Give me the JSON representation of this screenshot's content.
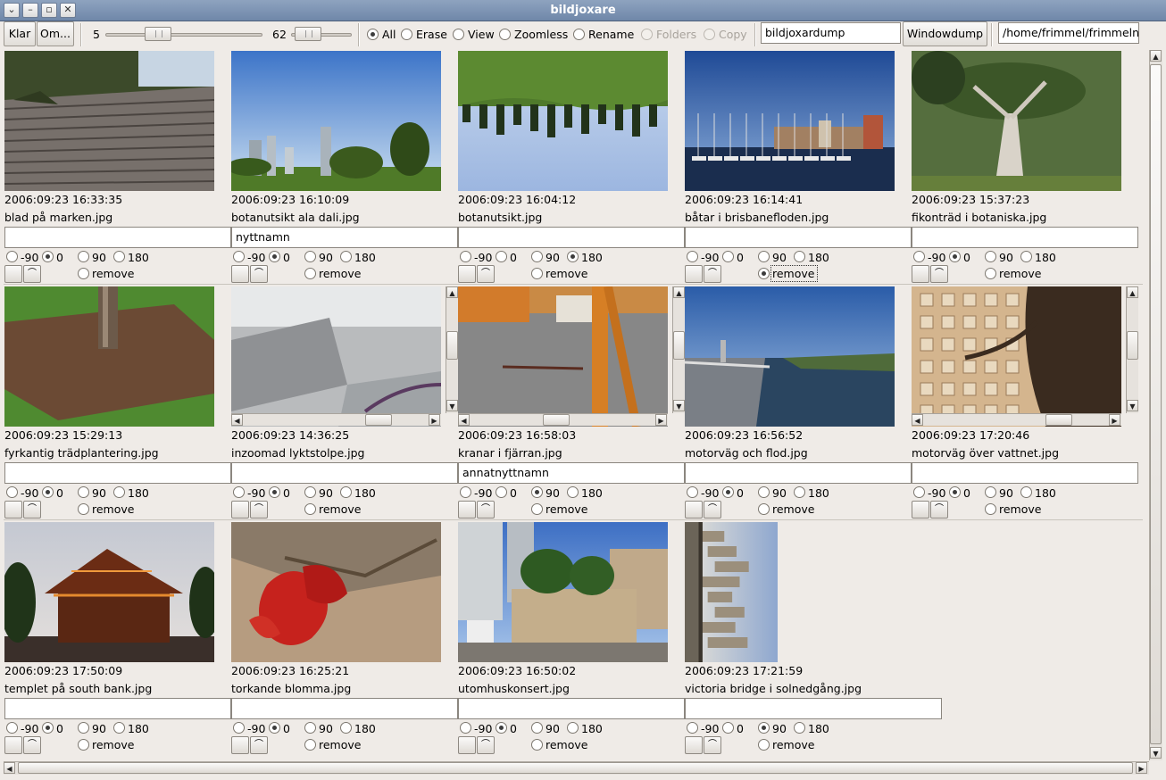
{
  "window": {
    "title": "bildjoxare"
  },
  "toolbar": {
    "klar_label": "Klar",
    "om_label": "Om...",
    "slider1_value": "5",
    "slider2_value": "62",
    "modes": [
      {
        "label": "All",
        "selected": true,
        "enabled": true
      },
      {
        "label": "Erase",
        "selected": false,
        "enabled": true
      },
      {
        "label": "View",
        "selected": false,
        "enabled": true
      },
      {
        "label": "Zoomless",
        "selected": false,
        "enabled": true
      },
      {
        "label": "Rename",
        "selected": false,
        "enabled": true
      },
      {
        "label": "Folders",
        "selected": false,
        "enabled": false
      },
      {
        "label": "Copy",
        "selected": false,
        "enabled": false
      }
    ],
    "dump_name": "bildjoxardump",
    "windowdump_label": "Windowdump",
    "path": "/home/frimmel/frimmelny"
  },
  "rotation_labels": {
    "m90": "-90",
    "r0": "0",
    "r90": "90",
    "r180": "180",
    "remove": "remove"
  },
  "rows": [
    [
      {
        "timestamp": "2006:09:23 16:33:35",
        "filename": "blad på marken.jpg",
        "rename": "",
        "rotation": "0",
        "remove": false,
        "img": "paving"
      },
      {
        "timestamp": "2006:09:23 16:10:09",
        "filename": "botanutsikt ala dali.jpg",
        "rename": "nyttnamn",
        "rotation": "0",
        "remove": false,
        "img": "skyline-park"
      },
      {
        "timestamp": "2006:09:23 16:04:12",
        "filename": "botanutsikt.jpg",
        "rename": "",
        "rotation": "180",
        "remove": false,
        "img": "upside-down"
      },
      {
        "timestamp": "2006:09:23 16:14:41",
        "filename": "båtar i brisbanefloden.jpg",
        "rename": "",
        "rotation": "",
        "remove": true,
        "img": "boats"
      },
      {
        "timestamp": "2006:09:23 15:37:23",
        "filename": "fikonträd i botaniska.jpg",
        "rename": "",
        "rotation": "0",
        "remove": false,
        "img": "fig-tree"
      }
    ],
    [
      {
        "timestamp": "2006:09:23 15:29:13",
        "filename": "fyrkantig trädplantering.jpg",
        "rename": "",
        "rotation": "0",
        "remove": false,
        "img": "tree-bed"
      },
      {
        "timestamp": "2006:09:23 14:36:25",
        "filename": "inzoomad lyktstolpe.jpg",
        "rename": "",
        "rotation": "0",
        "remove": false,
        "img": "lamp-zoom",
        "scroll": true
      },
      {
        "timestamp": "2006:09:23 16:58:03",
        "filename": "kranar i fjärran.jpg",
        "rename": "annatnyttnamn",
        "rotation": "90",
        "remove": false,
        "img": "crane",
        "scroll": true
      },
      {
        "timestamp": "2006:09:23 16:56:52",
        "filename": "motorväg och flod.jpg",
        "rename": "",
        "rotation": "0",
        "remove": false,
        "img": "river"
      },
      {
        "timestamp": "2006:09:23 17:20:46",
        "filename": "motorväg över vattnet.jpg",
        "rename": "",
        "rotation": "0",
        "remove": false,
        "img": "building-zoom",
        "scroll": true
      }
    ],
    [
      {
        "timestamp": "2006:09:23 17:50:09",
        "filename": "templet på south bank.jpg",
        "rename": "",
        "rotation": "0",
        "remove": false,
        "img": "temple"
      },
      {
        "timestamp": "2006:09:23 16:25:21",
        "filename": "torkande blomma.jpg",
        "rename": "",
        "rotation": "0",
        "remove": false,
        "img": "flower"
      },
      {
        "timestamp": "2006:09:23 16:50:02",
        "filename": "utomhuskonsert.jpg",
        "rename": "",
        "rotation": "0",
        "remove": false,
        "img": "concert"
      },
      {
        "timestamp": "2006:09:23 17:21:59",
        "filename": "victoria bridge i solnedgång.jpg",
        "rename": "",
        "rotation": "90",
        "remove": false,
        "img": "bridge-sunset",
        "portrait": true
      }
    ]
  ]
}
